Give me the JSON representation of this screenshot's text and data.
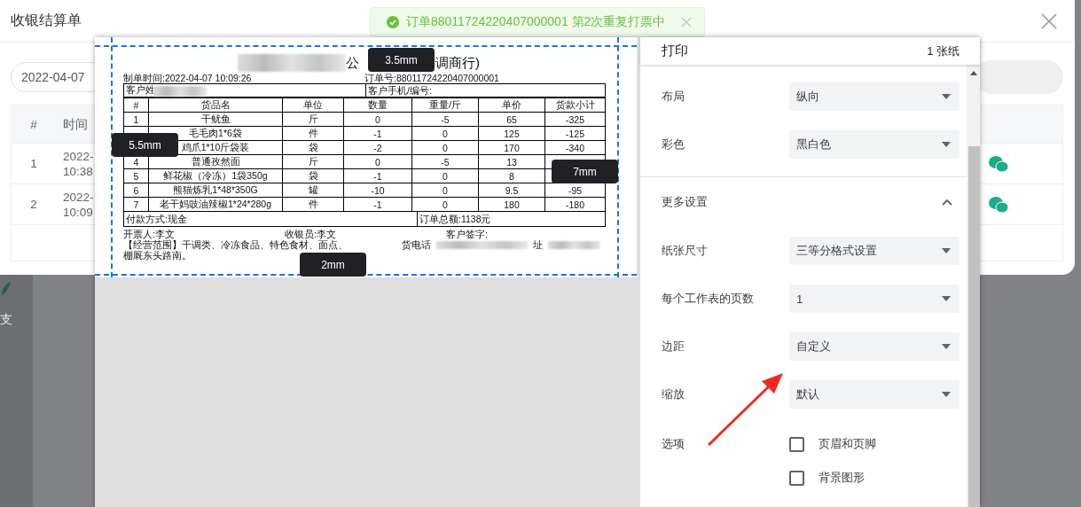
{
  "dialog": {
    "title": "收银结算单"
  },
  "date_field": {
    "value": "2022-04-07"
  },
  "orders_table": {
    "columns": [
      "#",
      "时间"
    ],
    "rows": [
      {
        "index": "1",
        "time": [
          "2022-",
          "10:38"
        ]
      },
      {
        "index": "2",
        "time": [
          "2022-",
          "10:09"
        ]
      }
    ]
  },
  "sidebar_label": "支",
  "toast": {
    "message": "订单88011724220407000001 第2次重复打票中"
  },
  "receipt": {
    "title_parts": [
      "公",
      "调商行)"
    ],
    "created": "制单时间:2022-04-07 10:09:26",
    "order_no": "订单号:88011724220407000001",
    "customer_name": "客户姓",
    "customer_phone": "客户手机/编号:",
    "columns": [
      "#",
      "货品名",
      "单位",
      "数量",
      "重量/斤",
      "单价",
      "货款小计"
    ],
    "rows": [
      [
        "1",
        "干鱿鱼",
        "斤",
        "0",
        "-5",
        "65",
        "-325"
      ],
      [
        null,
        "毛毛肉1*6袋",
        "件",
        "-1",
        "0",
        "125",
        "-125"
      ],
      [
        null,
        "鸡爪1*10斤袋装",
        "袋",
        "-2",
        "0",
        "170",
        "-340"
      ],
      [
        "4",
        "普通孜然面",
        "斤",
        "0",
        "-5",
        "13",
        null
      ],
      [
        "5",
        "鲜花椒（冷冻）1袋350g",
        "袋",
        "-1",
        "0",
        "8",
        null
      ],
      [
        "6",
        "熊猫炼乳1*48*350G",
        "罐",
        "-10",
        "0",
        "9.5",
        "-95"
      ],
      [
        "7",
        "老干妈豉油辣椒1*24*280g",
        "件",
        "-1",
        "0",
        "180",
        "-180"
      ]
    ],
    "payment": "付款方式:现金",
    "total": "订单总额:1138元",
    "issuer": "开票人:李文",
    "cashier": "收银员:李文",
    "signature": "客户签字:",
    "scope": "【经营范围】干调类、冷冻食品、特色食材、面点、",
    "phone_label": "货电话",
    "address_label": "址",
    "address_end": "棚厩东头路南。"
  },
  "margin_labels": [
    "3.5mm",
    "5.5mm",
    "7mm",
    "2mm"
  ],
  "print_settings": {
    "title": "打印",
    "sheets": "1 张纸",
    "rows": [
      {
        "kind": "select",
        "label": "布局",
        "value": "纵向"
      },
      {
        "kind": "select",
        "label": "彩色",
        "value": "黑白色"
      },
      {
        "kind": "section",
        "label": "更多设置",
        "expanded": true
      },
      {
        "kind": "select",
        "label": "纸张尺寸",
        "value": "三等分格式设置"
      },
      {
        "kind": "select",
        "label": "每个工作表的页数",
        "value": "1"
      },
      {
        "kind": "select",
        "label": "边距",
        "value": "自定义"
      },
      {
        "kind": "select",
        "label": "缩放",
        "value": "默认"
      },
      {
        "kind": "options",
        "label": "选项",
        "options": [
          {
            "label": "页眉和页脚",
            "checked": false
          },
          {
            "label": "背景图形",
            "checked": false
          }
        ]
      }
    ]
  }
}
